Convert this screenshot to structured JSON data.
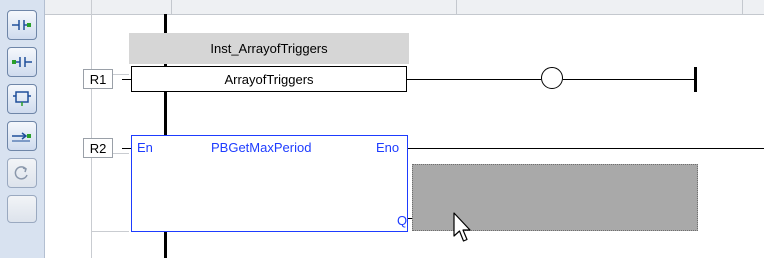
{
  "toolbar": {
    "buttons": [
      {
        "name": "insert-contact-parallel-button",
        "icon": "contact-parallel-icon",
        "enabled": true
      },
      {
        "name": "insert-contact-series-button",
        "icon": "contact-series-icon",
        "enabled": true
      },
      {
        "name": "insert-block-button",
        "icon": "block-icon",
        "enabled": true
      },
      {
        "name": "insert-coil-button",
        "icon": "coil-icon",
        "enabled": true
      },
      {
        "name": "loop-button",
        "icon": "loop-icon",
        "enabled": false
      }
    ]
  },
  "rungs": [
    {
      "label": "R1",
      "instance_name": "Inst_ArrayofTriggers",
      "variable": "ArrayofTriggers"
    },
    {
      "label": "R2",
      "block": {
        "name": "PBGetMaxPeriod",
        "input_pin": "En",
        "output_pins": [
          "Eno",
          "Q"
        ]
      }
    }
  ],
  "colors": {
    "block_border": "#1e3cff",
    "selection_fill": "#a9a9a9",
    "toolbar_bg": "#d8e2f0"
  }
}
